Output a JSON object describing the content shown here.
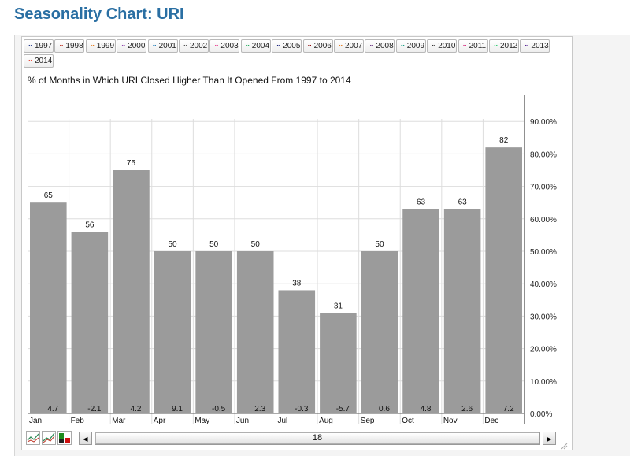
{
  "page": {
    "title": "Seasonality Chart: URI"
  },
  "legend": [
    {
      "label": "1997",
      "color": "#2a3f8f"
    },
    {
      "label": "1998",
      "color": "#c0392b"
    },
    {
      "label": "1999",
      "color": "#e67e22"
    },
    {
      "label": "2000",
      "color": "#8e44ad"
    },
    {
      "label": "2001",
      "color": "#2980b9"
    },
    {
      "label": "2002",
      "color": "#555555"
    },
    {
      "label": "2003",
      "color": "#e84393"
    },
    {
      "label": "2004",
      "color": "#27ae60"
    },
    {
      "label": "2005",
      "color": "#1a237e"
    },
    {
      "label": "2006",
      "color": "#8b0000"
    },
    {
      "label": "2007",
      "color": "#e67e22"
    },
    {
      "label": "2008",
      "color": "#6c3483"
    },
    {
      "label": "2009",
      "color": "#16a085"
    },
    {
      "label": "2010",
      "color": "#333333"
    },
    {
      "label": "2011",
      "color": "#d63384"
    },
    {
      "label": "2012",
      "color": "#2ecc71"
    },
    {
      "label": "2013",
      "color": "#4a148c"
    },
    {
      "label": "2014",
      "color": "#e74c3c"
    }
  ],
  "chart_data": {
    "type": "bar",
    "title": "% of Months in Which URI Closed Higher Than It Opened From 1997 to 2014",
    "categories": [
      "Jan",
      "Feb",
      "Mar",
      "Apr",
      "May",
      "Jun",
      "Jul",
      "Aug",
      "Sep",
      "Oct",
      "Nov",
      "Dec"
    ],
    "values": [
      65,
      56,
      75,
      50,
      50,
      50,
      38,
      31,
      50,
      63,
      63,
      82
    ],
    "bottom_labels": [
      "4.7",
      "-2.1",
      "4.2",
      "9.1",
      "-0.5",
      "2.3",
      "-0.3",
      "-5.7",
      "0.6",
      "4.8",
      "2.6",
      "7.2"
    ],
    "y_ticks": [
      "0.00%",
      "10.00%",
      "20.00%",
      "30.00%",
      "40.00%",
      "50.00%",
      "60.00%",
      "70.00%",
      "80.00%",
      "90.00%"
    ],
    "ylim": [
      0,
      100
    ],
    "bar_color": "#9b9b9b",
    "grid": true,
    "y_axis_position": "right"
  },
  "scrollbar": {
    "value": "18",
    "left_arrow": "◀",
    "right_arrow": "▶"
  }
}
